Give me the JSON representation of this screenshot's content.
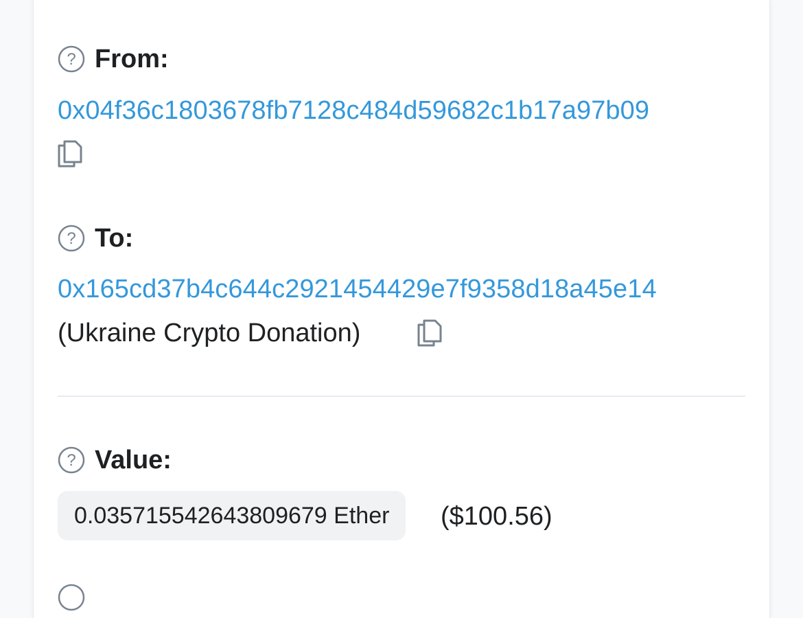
{
  "from": {
    "label": "From:",
    "address": "0x04f36c1803678fb7128c484d59682c1b17a97b09"
  },
  "to": {
    "label": "To:",
    "address": "0x165cd37b4c644c2921454429e7f9358d18a45e14",
    "name_tag": "(Ukraine Crypto Donation)"
  },
  "value": {
    "label": "Value:",
    "amount": "0.035715542643809679 Ether",
    "usd": "($100.56)"
  },
  "icons": {
    "help": "question-circle-icon",
    "copy": "copy-icon"
  },
  "colors": {
    "link": "#3498db",
    "text": "#1e2022",
    "badge_bg": "#f1f2f4"
  }
}
